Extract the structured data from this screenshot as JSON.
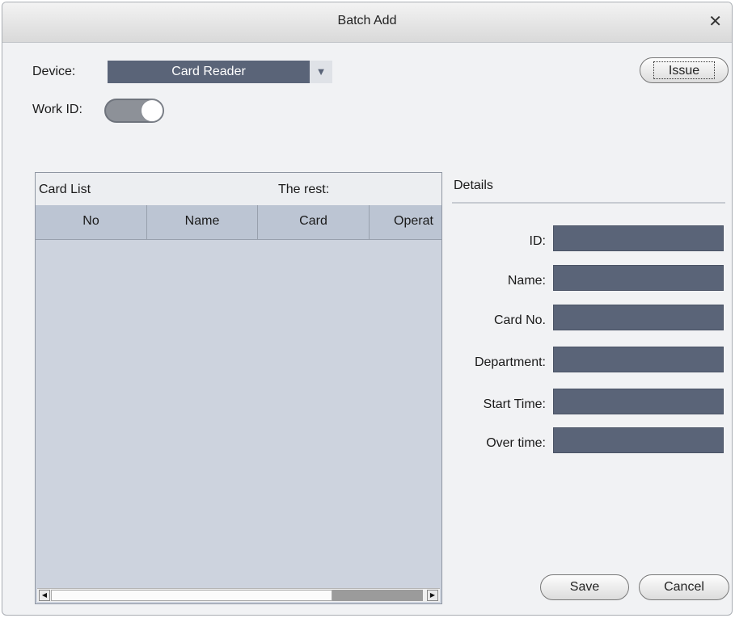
{
  "window": {
    "title": "Batch Add"
  },
  "device": {
    "label": "Device:",
    "value": "Card Reader"
  },
  "work_id": {
    "label": "Work ID:",
    "enabled": true
  },
  "issue_button": "Issue",
  "card_list": {
    "title": "Card List",
    "rest_label": "The rest:",
    "columns": [
      "No",
      "Name",
      "Card",
      "Operat"
    ],
    "rows": []
  },
  "details": {
    "title": "Details",
    "fields": [
      {
        "label": "ID:",
        "value": ""
      },
      {
        "label": "Name:",
        "value": ""
      },
      {
        "label": "Card No.",
        "value": ""
      },
      {
        "label": "Department:",
        "value": ""
      },
      {
        "label": "Start Time:",
        "value": ""
      },
      {
        "label": "Over time:",
        "value": ""
      }
    ]
  },
  "buttons": {
    "save": "Save",
    "cancel": "Cancel"
  },
  "colors": {
    "field_bg": "#5a6478",
    "list_bg": "#cdd3de",
    "header_bg": "#bcc5d3"
  }
}
